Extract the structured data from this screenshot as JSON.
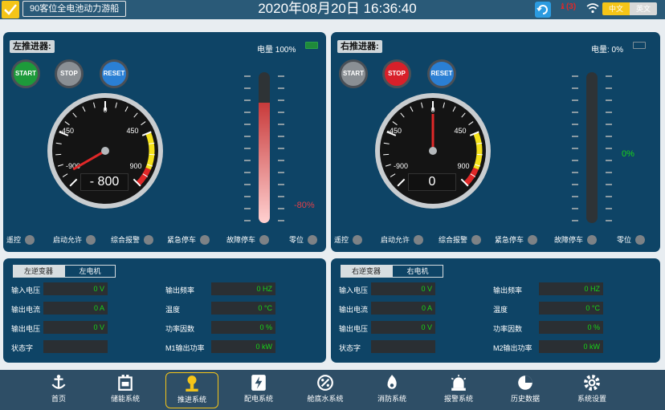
{
  "header": {
    "ship_name": "90客位全电池动力游船",
    "datetime": "2020年08月20日  16:36:40",
    "alarm_count": "(3)",
    "lang_cn": "中文",
    "lang_en": "英文"
  },
  "left": {
    "title": "左推进器:",
    "power_label": "电量 100%",
    "buttons": [
      "START",
      "STOP",
      "RESET"
    ],
    "gauge": {
      "value": -800,
      "display": "- 800",
      "labels": [
        "-900",
        "-450",
        "0",
        "450",
        "900"
      ]
    },
    "bar_percent": -80,
    "bar_label": "-80%",
    "status": [
      "遥控",
      "启动允许",
      "综合报警",
      "紧急停车",
      "故障停车",
      "零位"
    ],
    "tabs": [
      "左逆变器",
      "左电机"
    ],
    "rows_left": [
      {
        "label": "输入电压",
        "value": "0 V"
      },
      {
        "label": "输出电流",
        "value": "0 A"
      },
      {
        "label": "输出电压",
        "value": "0 V"
      },
      {
        "label": "状态字",
        "value": ""
      }
    ],
    "rows_right": [
      {
        "label": "输出频率",
        "value": "0 HZ"
      },
      {
        "label": "温度",
        "value": "0 °C"
      },
      {
        "label": "功率因数",
        "value": "0 %"
      },
      {
        "label": "M1输出功率",
        "value": "0 kW"
      }
    ]
  },
  "right": {
    "title": "右推进器:",
    "power_label": "电量: 0%",
    "buttons": [
      "START",
      "STOP",
      "RESET"
    ],
    "gauge": {
      "value": 0,
      "display": "0",
      "labels": [
        "-900",
        "-450",
        "0",
        "450",
        "900"
      ]
    },
    "bar_percent": 0,
    "bar_label": "0%",
    "status": [
      "遥控",
      "启动允许",
      "综合报警",
      "紧急停车",
      "故障停车",
      "零位"
    ],
    "tabs": [
      "右逆变器",
      "右电机"
    ],
    "rows_left": [
      {
        "label": "输入电压",
        "value": "0 V"
      },
      {
        "label": "输出电流",
        "value": "0 A"
      },
      {
        "label": "输出电压",
        "value": "0 V"
      },
      {
        "label": "状态字",
        "value": ""
      }
    ],
    "rows_right": [
      {
        "label": "输出频率",
        "value": "0 HZ"
      },
      {
        "label": "温度",
        "value": "0 °C"
      },
      {
        "label": "功率因数",
        "value": "0 %"
      },
      {
        "label": "M2输出功率",
        "value": "0 kW"
      }
    ]
  },
  "nav": [
    {
      "label": "首页",
      "icon": "anchor-icon"
    },
    {
      "label": "储能系统",
      "icon": "battery-icon"
    },
    {
      "label": "推进系统",
      "icon": "propeller-icon",
      "active": true
    },
    {
      "label": "配电系统",
      "icon": "lightning-icon"
    },
    {
      "label": "舱底水系统",
      "icon": "percent-icon"
    },
    {
      "label": "消防系统",
      "icon": "fire-icon"
    },
    {
      "label": "报警系统",
      "icon": "siren-icon"
    },
    {
      "label": "历史数据",
      "icon": "pie-chart-icon"
    },
    {
      "label": "系统设置",
      "icon": "gear-icon"
    }
  ],
  "colors": {
    "panel": "#0e4466",
    "start_green": "#1d9a3a",
    "stop_red": "#d8202a",
    "reset_blue": "#2a7fd4",
    "gray_btn": "#8a8f94",
    "value_green": "#18d418"
  }
}
